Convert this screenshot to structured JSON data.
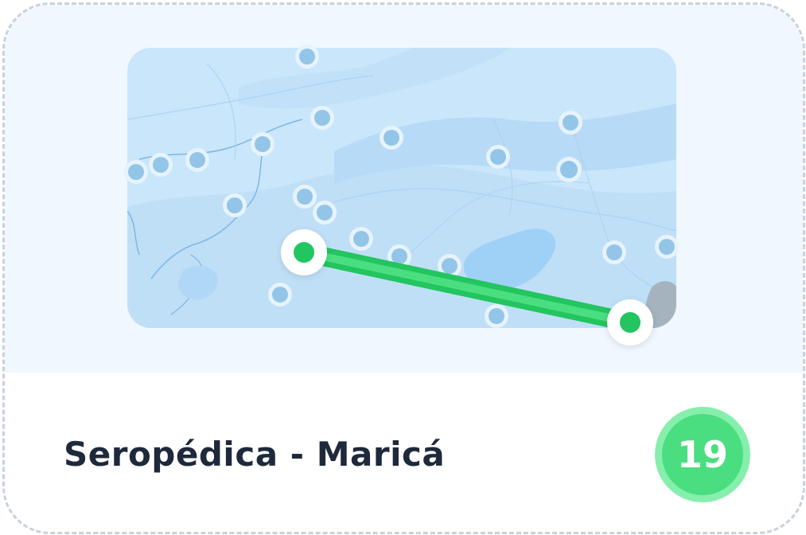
{
  "route": {
    "title": "Seropédica - Maricá",
    "line_number": "19"
  },
  "colors": {
    "route_line": "#22c55e",
    "route_line_light": "#4ade80",
    "badge_outer": "#86efac",
    "badge_inner": "#4ade80",
    "map_bg": "#c9e6fb",
    "water": "#9fd1f7",
    "stop_dot": "#93c5e8"
  },
  "icons": {
    "route_start": "map-pin-start-icon",
    "route_end": "map-pin-end-icon",
    "stop": "bus-stop-icon"
  }
}
